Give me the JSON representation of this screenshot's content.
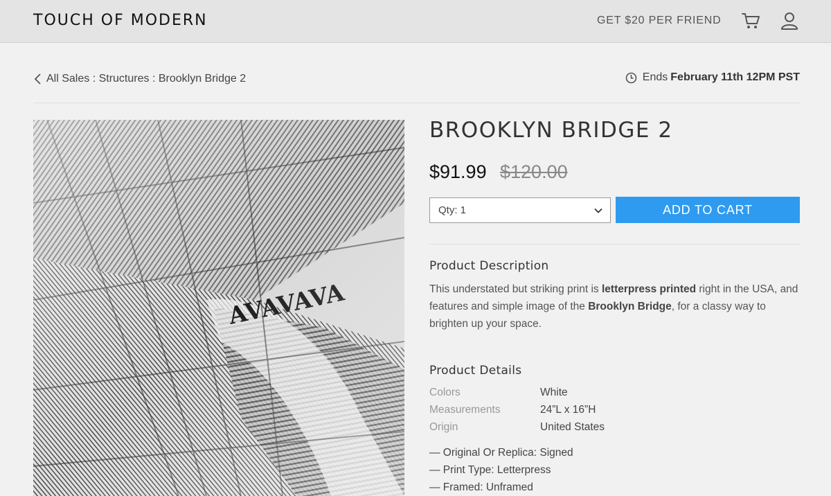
{
  "header": {
    "logo": "TOUCH OF MODERN",
    "referral": "GET $20 PER FRIEND",
    "cart_icon": "cart-icon",
    "account_icon": "user-icon"
  },
  "breadcrumb": {
    "text": "All Sales : Structures : Brooklyn Bridge 2"
  },
  "sale_end": {
    "prefix": "Ends",
    "date": "February 11th 12PM PST"
  },
  "product": {
    "title": "BROOKLYN BRIDGE 2",
    "price": "$91.99",
    "original_price": "$120.00",
    "quantity_label": "Qty: 1",
    "add_to_cart": "ADD TO CART",
    "accent_color": "#2e9bf0"
  },
  "description": {
    "heading": "Product Description",
    "text_1": "This understated but striking print is ",
    "bold_1": "letterpress printed",
    "text_2": " right in the USA, and features and simple image of the ",
    "bold_2": "Brooklyn Bridge",
    "text_3": ", for a classy way to brighten up your space."
  },
  "details": {
    "heading": "Product Details",
    "rows": [
      {
        "label": "Colors",
        "value": "White"
      },
      {
        "label": "Measurements",
        "value": "24”L x 16”H"
      },
      {
        "label": "Origin",
        "value": "United States"
      }
    ],
    "bullets": [
      "— Original Or Replica: Signed",
      "— Print Type: Letterpress",
      "— Framed: Unframed"
    ]
  }
}
